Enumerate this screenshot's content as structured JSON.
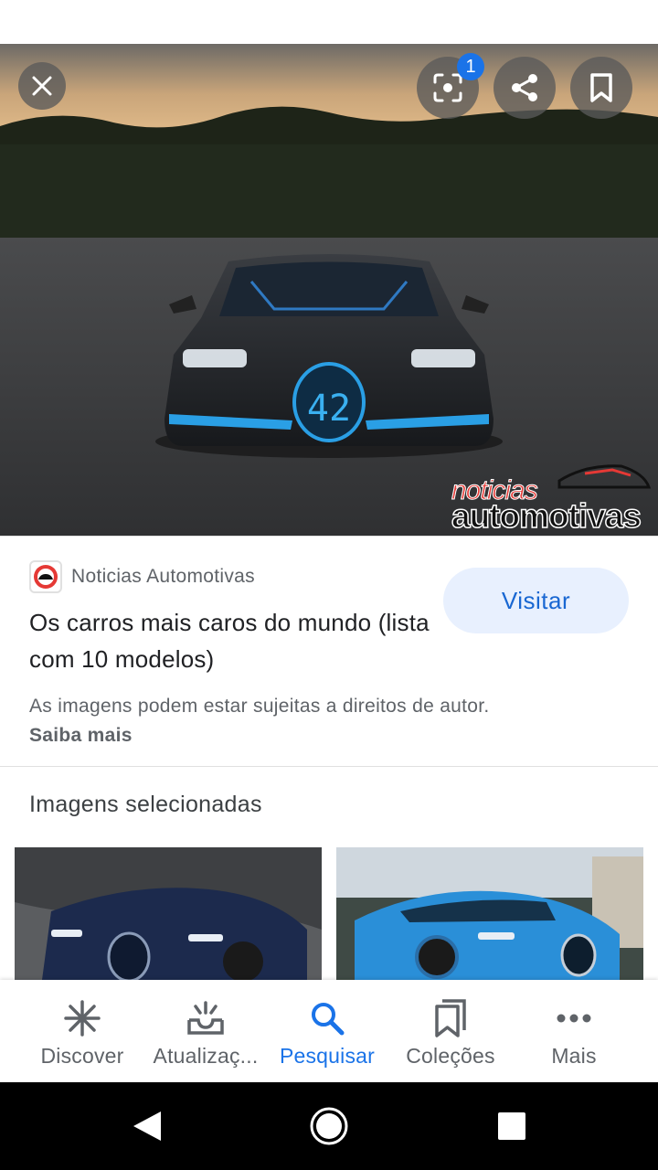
{
  "viewer": {
    "lens_badge_count": "1",
    "watermark_top": "noticias",
    "watermark_bottom": "automotivas",
    "plate_text": "42"
  },
  "result": {
    "source_name": "Noticias Automotivas",
    "title": "Os carros mais caros do mundo (lista com 10 modelos)",
    "visit_label": "Visitar",
    "copyright_notice": "As imagens podem estar sujeitas a direitos de autor.",
    "learn_more": "Saiba mais"
  },
  "related": {
    "section_title": "Imagens selecionadas"
  },
  "bottom_nav": {
    "items": [
      {
        "label": "Discover",
        "icon": "asterisk-icon"
      },
      {
        "label": "Atualizaç...",
        "icon": "tray-updates-icon"
      },
      {
        "label": "Pesquisar",
        "icon": "search-icon"
      },
      {
        "label": "Coleções",
        "icon": "bookmarks-icon"
      },
      {
        "label": "Mais",
        "icon": "more-dots-icon"
      }
    ],
    "active_index": 2
  },
  "colors": {
    "accent": "#1a73e8",
    "visit_bg": "#e8f0fe",
    "text_secondary": "#5f6368"
  }
}
